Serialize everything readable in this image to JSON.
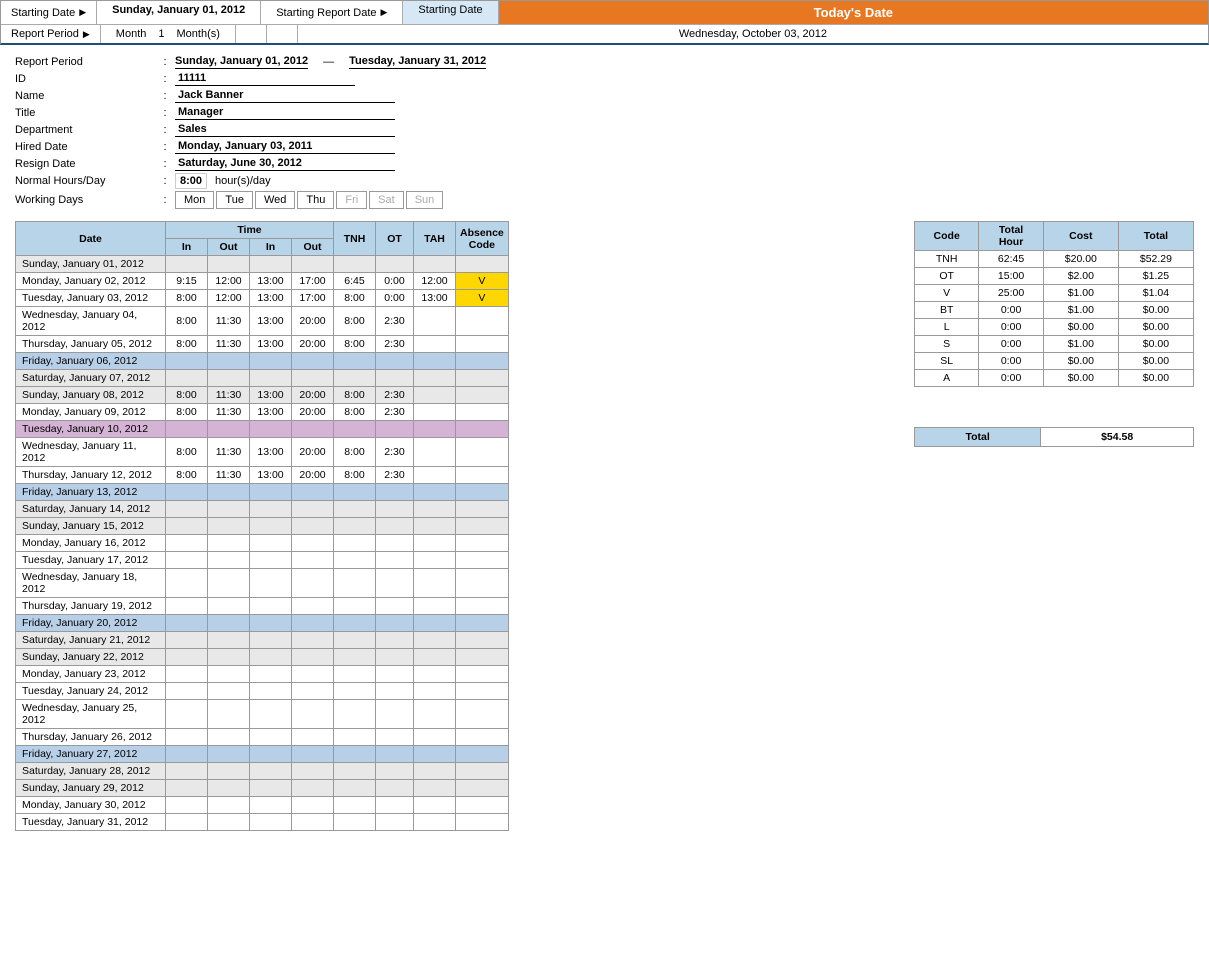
{
  "header": {
    "starting_date_label": "Starting Date",
    "starting_date_value": "Sunday, January 01, 2012",
    "starting_report_date_label": "Starting Report Date",
    "starting_date_ref": "Starting Date",
    "todays_date_label": "Today's Date",
    "todays_date_value": "Wednesday, October 03, 2012",
    "report_period_label": "Report Period",
    "report_period_value": "Month",
    "report_period_num": "1",
    "report_period_unit": "Month(s)"
  },
  "info": {
    "report_period_label": "Report Period",
    "report_period_from": "Sunday, January 01, 2012",
    "report_period_to": "Tuesday, January 31, 2012",
    "id_label": "ID",
    "id_value": "11111",
    "name_label": "Name",
    "name_value": "Jack Banner",
    "title_label": "Title",
    "title_value": "Manager",
    "department_label": "Department",
    "department_value": "Sales",
    "hired_date_label": "Hired Date",
    "hired_date_value": "Monday, January 03, 2011",
    "resign_date_label": "Resign Date",
    "resign_date_value": "Saturday, June 30, 2012",
    "normal_hours_label": "Normal Hours/Day",
    "normal_hours_value": "8:00",
    "normal_hours_unit": "hour(s)/day",
    "working_days_label": "Working Days",
    "days": [
      "Mon",
      "Tue",
      "Wed",
      "Thu",
      "Fri",
      "Sat",
      "Sun"
    ],
    "active_days": [
      true,
      true,
      true,
      true,
      false,
      false,
      false
    ]
  },
  "attendance_table": {
    "headers": {
      "date": "Date",
      "time": "Time",
      "tnh": "TNH",
      "ot": "OT",
      "tah": "TAH",
      "absence_code": "Absence Code",
      "in1": "In",
      "out1": "Out",
      "in2": "In",
      "out2": "Out"
    },
    "rows": [
      {
        "date": "Sunday, January 01, 2012",
        "type": "sunday",
        "in1": "",
        "out1": "",
        "in2": "",
        "out2": "",
        "tnh": "",
        "ot": "",
        "tah": "",
        "absence": ""
      },
      {
        "date": "Monday, January 02, 2012",
        "type": "normal",
        "in1": "9:15",
        "out1": "12:00",
        "in2": "13:00",
        "out2": "17:00",
        "tnh": "6:45",
        "ot": "0:00",
        "tah": "12:00",
        "absence": "V",
        "absence_yellow": true
      },
      {
        "date": "Tuesday, January 03, 2012",
        "type": "normal",
        "in1": "8:00",
        "out1": "12:00",
        "in2": "13:00",
        "out2": "17:00",
        "tnh": "8:00",
        "ot": "0:00",
        "tah": "13:00",
        "absence": "V",
        "absence_yellow": true
      },
      {
        "date": "Wednesday, January 04, 2012",
        "type": "normal",
        "in1": "8:00",
        "out1": "11:30",
        "in2": "13:00",
        "out2": "20:00",
        "tnh": "8:00",
        "ot": "2:30",
        "tah": "",
        "absence": ""
      },
      {
        "date": "Thursday, January 05, 2012",
        "type": "normal",
        "in1": "8:00",
        "out1": "11:30",
        "in2": "13:00",
        "out2": "20:00",
        "tnh": "8:00",
        "ot": "2:30",
        "tah": "",
        "absence": ""
      },
      {
        "date": "Friday, January 06, 2012",
        "type": "friday",
        "in1": "",
        "out1": "",
        "in2": "",
        "out2": "",
        "tnh": "",
        "ot": "",
        "tah": "",
        "absence": ""
      },
      {
        "date": "Saturday, January 07, 2012",
        "type": "saturday",
        "in1": "",
        "out1": "",
        "in2": "",
        "out2": "",
        "tnh": "",
        "ot": "",
        "tah": "",
        "absence": ""
      },
      {
        "date": "Sunday, January 08, 2012",
        "type": "sunday",
        "in1": "8:00",
        "out1": "11:30",
        "in2": "13:00",
        "out2": "20:00",
        "tnh": "8:00",
        "ot": "2:30",
        "tah": "",
        "absence": ""
      },
      {
        "date": "Monday, January 09, 2012",
        "type": "normal",
        "in1": "8:00",
        "out1": "11:30",
        "in2": "13:00",
        "out2": "20:00",
        "tnh": "8:00",
        "ot": "2:30",
        "tah": "",
        "absence": ""
      },
      {
        "date": "Tuesday, January 10, 2012",
        "type": "tuesday",
        "in1": "",
        "out1": "",
        "in2": "",
        "out2": "",
        "tnh": "",
        "ot": "",
        "tah": "",
        "absence": ""
      },
      {
        "date": "Wednesday, January 11, 2012",
        "type": "normal",
        "in1": "8:00",
        "out1": "11:30",
        "in2": "13:00",
        "out2": "20:00",
        "tnh": "8:00",
        "ot": "2:30",
        "tah": "",
        "absence": ""
      },
      {
        "date": "Thursday, January 12, 2012",
        "type": "normal",
        "in1": "8:00",
        "out1": "11:30",
        "in2": "13:00",
        "out2": "20:00",
        "tnh": "8:00",
        "ot": "2:30",
        "tah": "",
        "absence": ""
      },
      {
        "date": "Friday, January 13, 2012",
        "type": "friday",
        "in1": "",
        "out1": "",
        "in2": "",
        "out2": "",
        "tnh": "",
        "ot": "",
        "tah": "",
        "absence": ""
      },
      {
        "date": "Saturday, January 14, 2012",
        "type": "saturday",
        "in1": "",
        "out1": "",
        "in2": "",
        "out2": "",
        "tnh": "",
        "ot": "",
        "tah": "",
        "absence": ""
      },
      {
        "date": "Sunday, January 15, 2012",
        "type": "sunday",
        "in1": "",
        "out1": "",
        "in2": "",
        "out2": "",
        "tnh": "",
        "ot": "",
        "tah": "",
        "absence": ""
      },
      {
        "date": "Monday, January 16, 2012",
        "type": "normal",
        "in1": "",
        "out1": "",
        "in2": "",
        "out2": "",
        "tnh": "",
        "ot": "",
        "tah": "",
        "absence": ""
      },
      {
        "date": "Tuesday, January 17, 2012",
        "type": "normal",
        "in1": "",
        "out1": "",
        "in2": "",
        "out2": "",
        "tnh": "",
        "ot": "",
        "tah": "",
        "absence": ""
      },
      {
        "date": "Wednesday, January 18, 2012",
        "type": "normal",
        "in1": "",
        "out1": "",
        "in2": "",
        "out2": "",
        "tnh": "",
        "ot": "",
        "tah": "",
        "absence": ""
      },
      {
        "date": "Thursday, January 19, 2012",
        "type": "normal",
        "in1": "",
        "out1": "",
        "in2": "",
        "out2": "",
        "tnh": "",
        "ot": "",
        "tah": "",
        "absence": ""
      },
      {
        "date": "Friday, January 20, 2012",
        "type": "friday",
        "in1": "",
        "out1": "",
        "in2": "",
        "out2": "",
        "tnh": "",
        "ot": "",
        "tah": "",
        "absence": ""
      },
      {
        "date": "Saturday, January 21, 2012",
        "type": "saturday",
        "in1": "",
        "out1": "",
        "in2": "",
        "out2": "",
        "tnh": "",
        "ot": "",
        "tah": "",
        "absence": ""
      },
      {
        "date": "Sunday, January 22, 2012",
        "type": "sunday",
        "in1": "",
        "out1": "",
        "in2": "",
        "out2": "",
        "tnh": "",
        "ot": "",
        "tah": "",
        "absence": ""
      },
      {
        "date": "Monday, January 23, 2012",
        "type": "normal",
        "in1": "",
        "out1": "",
        "in2": "",
        "out2": "",
        "tnh": "",
        "ot": "",
        "tah": "",
        "absence": ""
      },
      {
        "date": "Tuesday, January 24, 2012",
        "type": "normal",
        "in1": "",
        "out1": "",
        "in2": "",
        "out2": "",
        "tnh": "",
        "ot": "",
        "tah": "",
        "absence": ""
      },
      {
        "date": "Wednesday, January 25, 2012",
        "type": "normal",
        "in1": "",
        "out1": "",
        "in2": "",
        "out2": "",
        "tnh": "",
        "ot": "",
        "tah": "",
        "absence": ""
      },
      {
        "date": "Thursday, January 26, 2012",
        "type": "normal",
        "in1": "",
        "out1": "",
        "in2": "",
        "out2": "",
        "tnh": "",
        "ot": "",
        "tah": "",
        "absence": ""
      },
      {
        "date": "Friday, January 27, 2012",
        "type": "friday",
        "in1": "",
        "out1": "",
        "in2": "",
        "out2": "",
        "tnh": "",
        "ot": "",
        "tah": "",
        "absence": ""
      },
      {
        "date": "Saturday, January 28, 2012",
        "type": "saturday",
        "in1": "",
        "out1": "",
        "in2": "",
        "out2": "",
        "tnh": "",
        "ot": "",
        "tah": "",
        "absence": ""
      },
      {
        "date": "Sunday, January 29, 2012",
        "type": "sunday",
        "in1": "",
        "out1": "",
        "in2": "",
        "out2": "",
        "tnh": "",
        "ot": "",
        "tah": "",
        "absence": ""
      },
      {
        "date": "Monday, January 30, 2012",
        "type": "normal",
        "in1": "",
        "out1": "",
        "in2": "",
        "out2": "",
        "tnh": "",
        "ot": "",
        "tah": "",
        "absence": ""
      },
      {
        "date": "Tuesday, January 31, 2012",
        "type": "normal",
        "in1": "",
        "out1": "",
        "in2": "",
        "out2": "",
        "tnh": "",
        "ot": "",
        "tah": "",
        "absence": ""
      }
    ]
  },
  "summary": {
    "headers": [
      "Code",
      "Total Hour",
      "Cost",
      "Total"
    ],
    "rows": [
      {
        "code": "TNH",
        "hour": "62:45",
        "cost": "$20.00",
        "total": "$52.29"
      },
      {
        "code": "OT",
        "hour": "15:00",
        "cost": "$2.00",
        "total": "$1.25"
      },
      {
        "code": "V",
        "hour": "25:00",
        "cost": "$1.00",
        "total": "$1.04"
      },
      {
        "code": "BT",
        "hour": "0:00",
        "cost": "$1.00",
        "total": "$0.00"
      },
      {
        "code": "L",
        "hour": "0:00",
        "cost": "$0.00",
        "total": "$0.00"
      },
      {
        "code": "S",
        "hour": "0:00",
        "cost": "$1.00",
        "total": "$0.00"
      },
      {
        "code": "SL",
        "hour": "0:00",
        "cost": "$0.00",
        "total": "$0.00"
      },
      {
        "code": "A",
        "hour": "0:00",
        "cost": "$0.00",
        "total": "$0.00"
      }
    ],
    "total_label": "Total",
    "total_value": "$54.58"
  }
}
